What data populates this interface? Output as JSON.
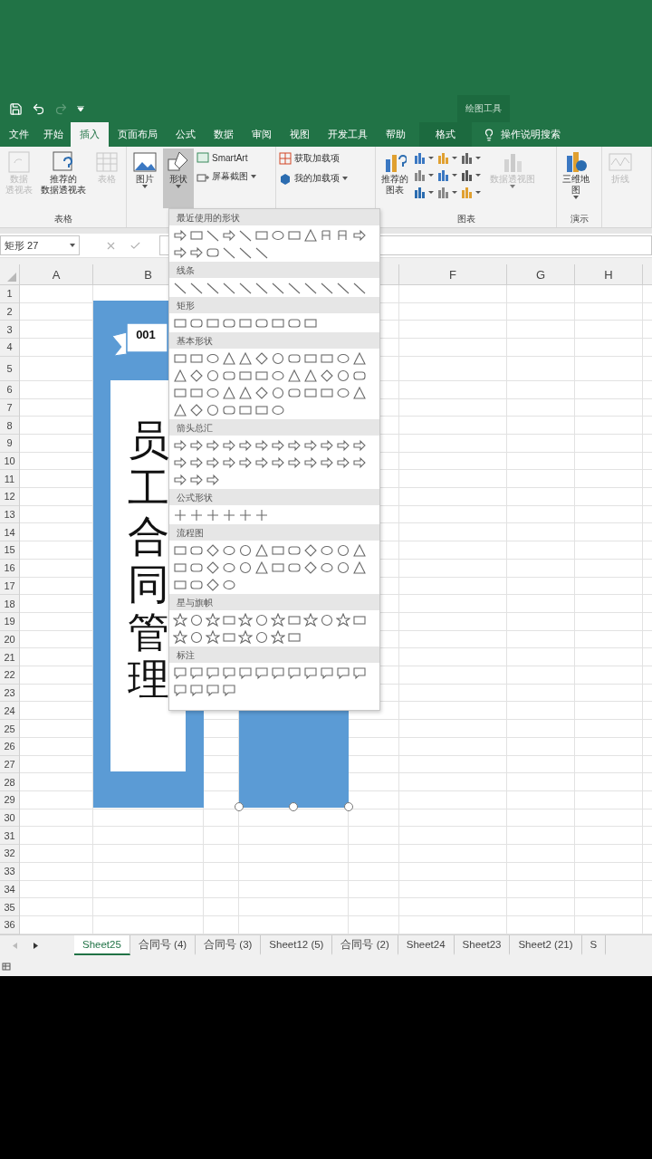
{
  "quick_access": {
    "context_title": "绘图工具"
  },
  "tabs": [
    {
      "label": "文件",
      "selected": false,
      "kind": "standard"
    },
    {
      "label": "开始",
      "selected": false,
      "kind": "standard"
    },
    {
      "label": "插入",
      "selected": true,
      "kind": "standard"
    },
    {
      "label": "页面布局",
      "selected": false,
      "kind": "standard"
    },
    {
      "label": "公式",
      "selected": false,
      "kind": "standard"
    },
    {
      "label": "数据",
      "selected": false,
      "kind": "standard"
    },
    {
      "label": "审阅",
      "selected": false,
      "kind": "standard"
    },
    {
      "label": "视图",
      "selected": false,
      "kind": "standard"
    },
    {
      "label": "开发工具",
      "selected": false,
      "kind": "standard"
    },
    {
      "label": "帮助",
      "selected": false,
      "kind": "standard"
    },
    {
      "label": "格式",
      "selected": false,
      "kind": "contextual"
    }
  ],
  "search": {
    "placeholder": "操作说明搜索"
  },
  "ribbon": {
    "groups": [
      {
        "label": "表格",
        "items": [
          {
            "kind": "large",
            "lines": [
              "数据",
              "透视表"
            ],
            "disabled": true,
            "pressed": false,
            "dropdown": false
          },
          {
            "kind": "large",
            "lines": [
              "推荐的",
              "数据透视表"
            ],
            "disabled": false,
            "pressed": false,
            "dropdown": false
          },
          {
            "kind": "large",
            "lines": [
              "表格"
            ],
            "disabled": true,
            "pressed": false,
            "dropdown": false
          }
        ]
      },
      {
        "items": [
          {
            "kind": "large",
            "lines": [
              "图片"
            ],
            "disabled": false,
            "pressed": false,
            "dropdown": true
          },
          {
            "kind": "large",
            "lines": [
              "形状"
            ],
            "disabled": false,
            "pressed": true,
            "dropdown": true
          },
          {
            "kind": "small",
            "label": "SmartArt",
            "dropdown": false
          },
          {
            "kind": "small",
            "label": "屏幕截图",
            "dropdown": true
          }
        ]
      },
      {
        "items": [
          {
            "kind": "small",
            "label": "获取加载项",
            "dropdown": false
          },
          {
            "kind": "small",
            "label": "我的加载项",
            "dropdown": true
          }
        ]
      },
      {
        "label": "图表",
        "items": [
          {
            "kind": "large",
            "lines": [
              "推荐的",
              "图表"
            ],
            "disabled": false,
            "pressed": false,
            "dropdown": false
          },
          {
            "kind": "chart-icons"
          },
          {
            "kind": "large",
            "lines": [
              "数据透视图"
            ],
            "disabled": true,
            "pressed": false,
            "dropdown": true
          }
        ]
      },
      {
        "label": "演示",
        "items": [
          {
            "kind": "large",
            "lines": [
              "三维地",
              "图"
            ],
            "disabled": false,
            "pressed": false,
            "dropdown": true
          }
        ]
      },
      {
        "items": [
          {
            "kind": "large",
            "lines": [
              "折线"
            ],
            "disabled": true,
            "pressed": false,
            "dropdown": false
          }
        ]
      }
    ]
  },
  "formula_bar": {
    "name_box": "矩形 27"
  },
  "columns": [
    "A",
    "B",
    "F",
    "G",
    "H"
  ],
  "rows": [
    "1",
    "2",
    "3",
    "4",
    "5",
    "6",
    "7",
    "8",
    "9",
    "10",
    "11",
    "12",
    "13",
    "14",
    "15",
    "16",
    "17",
    "18",
    "19",
    "20",
    "21",
    "22",
    "23",
    "24",
    "25",
    "26",
    "27",
    "28",
    "29",
    "30",
    "31",
    "32",
    "33",
    "34",
    "35",
    "36"
  ],
  "canvas": {
    "badge": "001",
    "title": "员工合同管理"
  },
  "shapes_menu": {
    "categories": [
      {
        "label": "最近使用的形状"
      },
      {
        "label": "线条"
      },
      {
        "label": "矩形"
      },
      {
        "label": "基本形状"
      },
      {
        "label": "箭头总汇"
      },
      {
        "label": "公式形状"
      },
      {
        "label": "流程图"
      },
      {
        "label": "星与旗帜"
      },
      {
        "label": "标注"
      }
    ]
  },
  "sheet_tabs": [
    {
      "label": "Sheet25",
      "selected": true
    },
    {
      "label": "合同号 (4)",
      "selected": false
    },
    {
      "label": "合同号 (3)",
      "selected": false
    },
    {
      "label": "Sheet12 (5)",
      "selected": false
    },
    {
      "label": "合同号 (2)",
      "selected": false
    },
    {
      "label": "Sheet24",
      "selected": false
    },
    {
      "label": "Sheet23",
      "selected": false
    },
    {
      "label": "Sheet2 (21)",
      "selected": false
    },
    {
      "label": "S",
      "selected": false
    }
  ]
}
